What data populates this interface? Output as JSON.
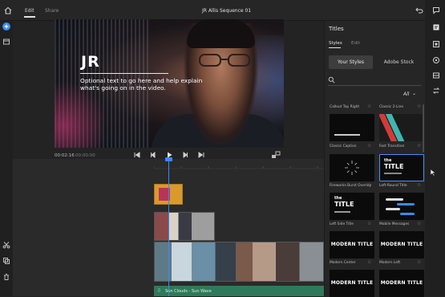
{
  "header": {
    "tab_edit": "Edit",
    "tab_share": "Share",
    "sequence_title": "JR Allis Sequence 01"
  },
  "monitor": {
    "overlay_logo": "JR",
    "overlay_text": "Optional text to go here and help explain what's going on in the video.",
    "timecode_current": "00:02:16",
    "timecode_total": "00:00:00"
  },
  "timeline": {
    "audio_clip_label": "Sun Clouds - Sun Wave"
  },
  "titles_panel": {
    "heading": "Titles",
    "tab_styles": "Styles",
    "tab_edit": "Edit",
    "your_styles_button": "Your Styles",
    "adobe_stock_button": "Adobe Stock",
    "filter_label": "All",
    "rows": [
      {
        "left": "Callout Top Right",
        "right": "Classic 2-Line"
      },
      {
        "left": "Classic Caption",
        "right": "Fast Transition"
      },
      {
        "left": "Fireworks Burst Overlay",
        "right": "Left-Round Title"
      },
      {
        "left": "Left Side Title",
        "right": "Mobile Messages"
      },
      {
        "left": "Modern Center",
        "right": "Modern Left"
      },
      {
        "left": "",
        "right": ""
      }
    ],
    "thumb_texts": {
      "the": "the",
      "title": "TITLE",
      "modern_title": "MODERN TITLE"
    }
  },
  "colors": {
    "accent": "#3a8bf0",
    "clip_title": "#d99a2c",
    "audio": "#2e7a5a"
  }
}
